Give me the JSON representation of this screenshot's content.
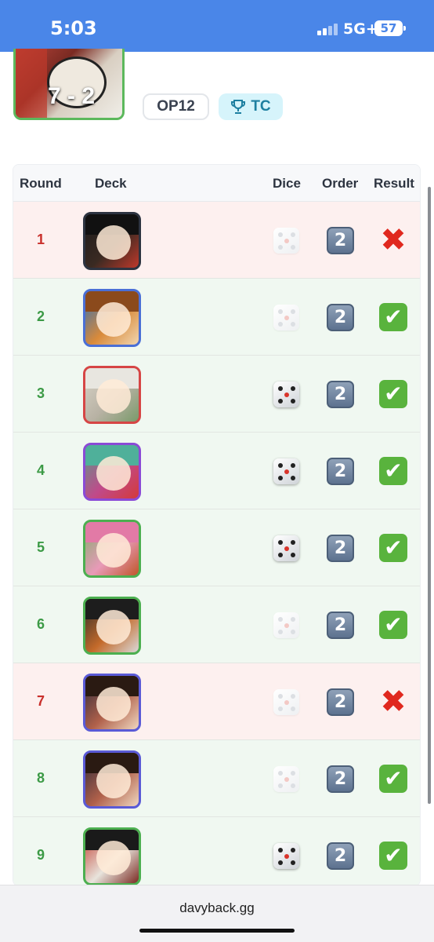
{
  "status_bar": {
    "time": "5:03",
    "network": "5G+",
    "battery": "57"
  },
  "match": {
    "score": "7 - 2",
    "set_badge": "OP12",
    "event_badge": "TC",
    "event_icon": "trophy-icon"
  },
  "table": {
    "headers": {
      "round": "Round",
      "deck": "Deck",
      "dice": "Dice",
      "order": "Order",
      "result": "Result"
    },
    "rows": [
      {
        "round": "1",
        "order": "2",
        "outcome": "loss",
        "dice_won": false
      },
      {
        "round": "2",
        "order": "2",
        "outcome": "win",
        "dice_won": false
      },
      {
        "round": "3",
        "order": "2",
        "outcome": "win",
        "dice_won": true
      },
      {
        "round": "4",
        "order": "2",
        "outcome": "win",
        "dice_won": true
      },
      {
        "round": "5",
        "order": "2",
        "outcome": "win",
        "dice_won": true
      },
      {
        "round": "6",
        "order": "2",
        "outcome": "win",
        "dice_won": false
      },
      {
        "round": "7",
        "order": "2",
        "outcome": "loss",
        "dice_won": false
      },
      {
        "round": "8",
        "order": "2",
        "outcome": "win",
        "dice_won": false
      },
      {
        "round": "9",
        "order": "2",
        "outcome": "win",
        "dice_won": true
      }
    ]
  },
  "colors": {
    "status_bar": "#4a86e8",
    "loss_row": "#fdf0ef",
    "win_row": "#f0f8f1",
    "win_text": "#3c9a46",
    "loss_text": "#c9302c"
  },
  "browser": {
    "url": "davyback.gg"
  }
}
